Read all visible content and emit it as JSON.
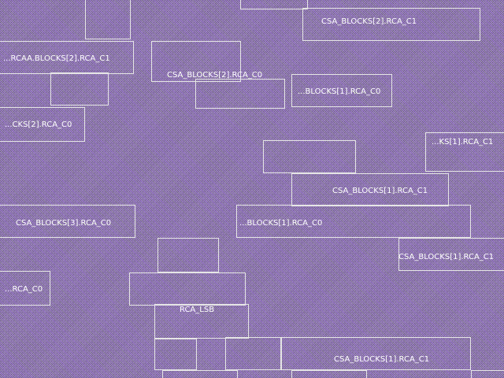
{
  "labels": [
    "CSA_BLOCKS[2].RCA_C1",
    "...RCAA.BLOCKS[2].RCA_C1",
    "CSA_BLOCKS[2].RCA_C0",
    "...BLOCKS[1].RCA_C0",
    "...CKS[2].RCA_C0",
    "...KS[1].RCA_C1",
    "CSA_BLOCKS[1].RCA_C1",
    "CSA_BLOCKS[3].RCA_C0",
    "...BLOCKS[1].RCA_C0",
    "CSA_BLOCKS[1].RCA_C1",
    "...RCA_C0",
    "RCA_LSB",
    "CSA_BLOCKS[1].RCA_C1"
  ]
}
